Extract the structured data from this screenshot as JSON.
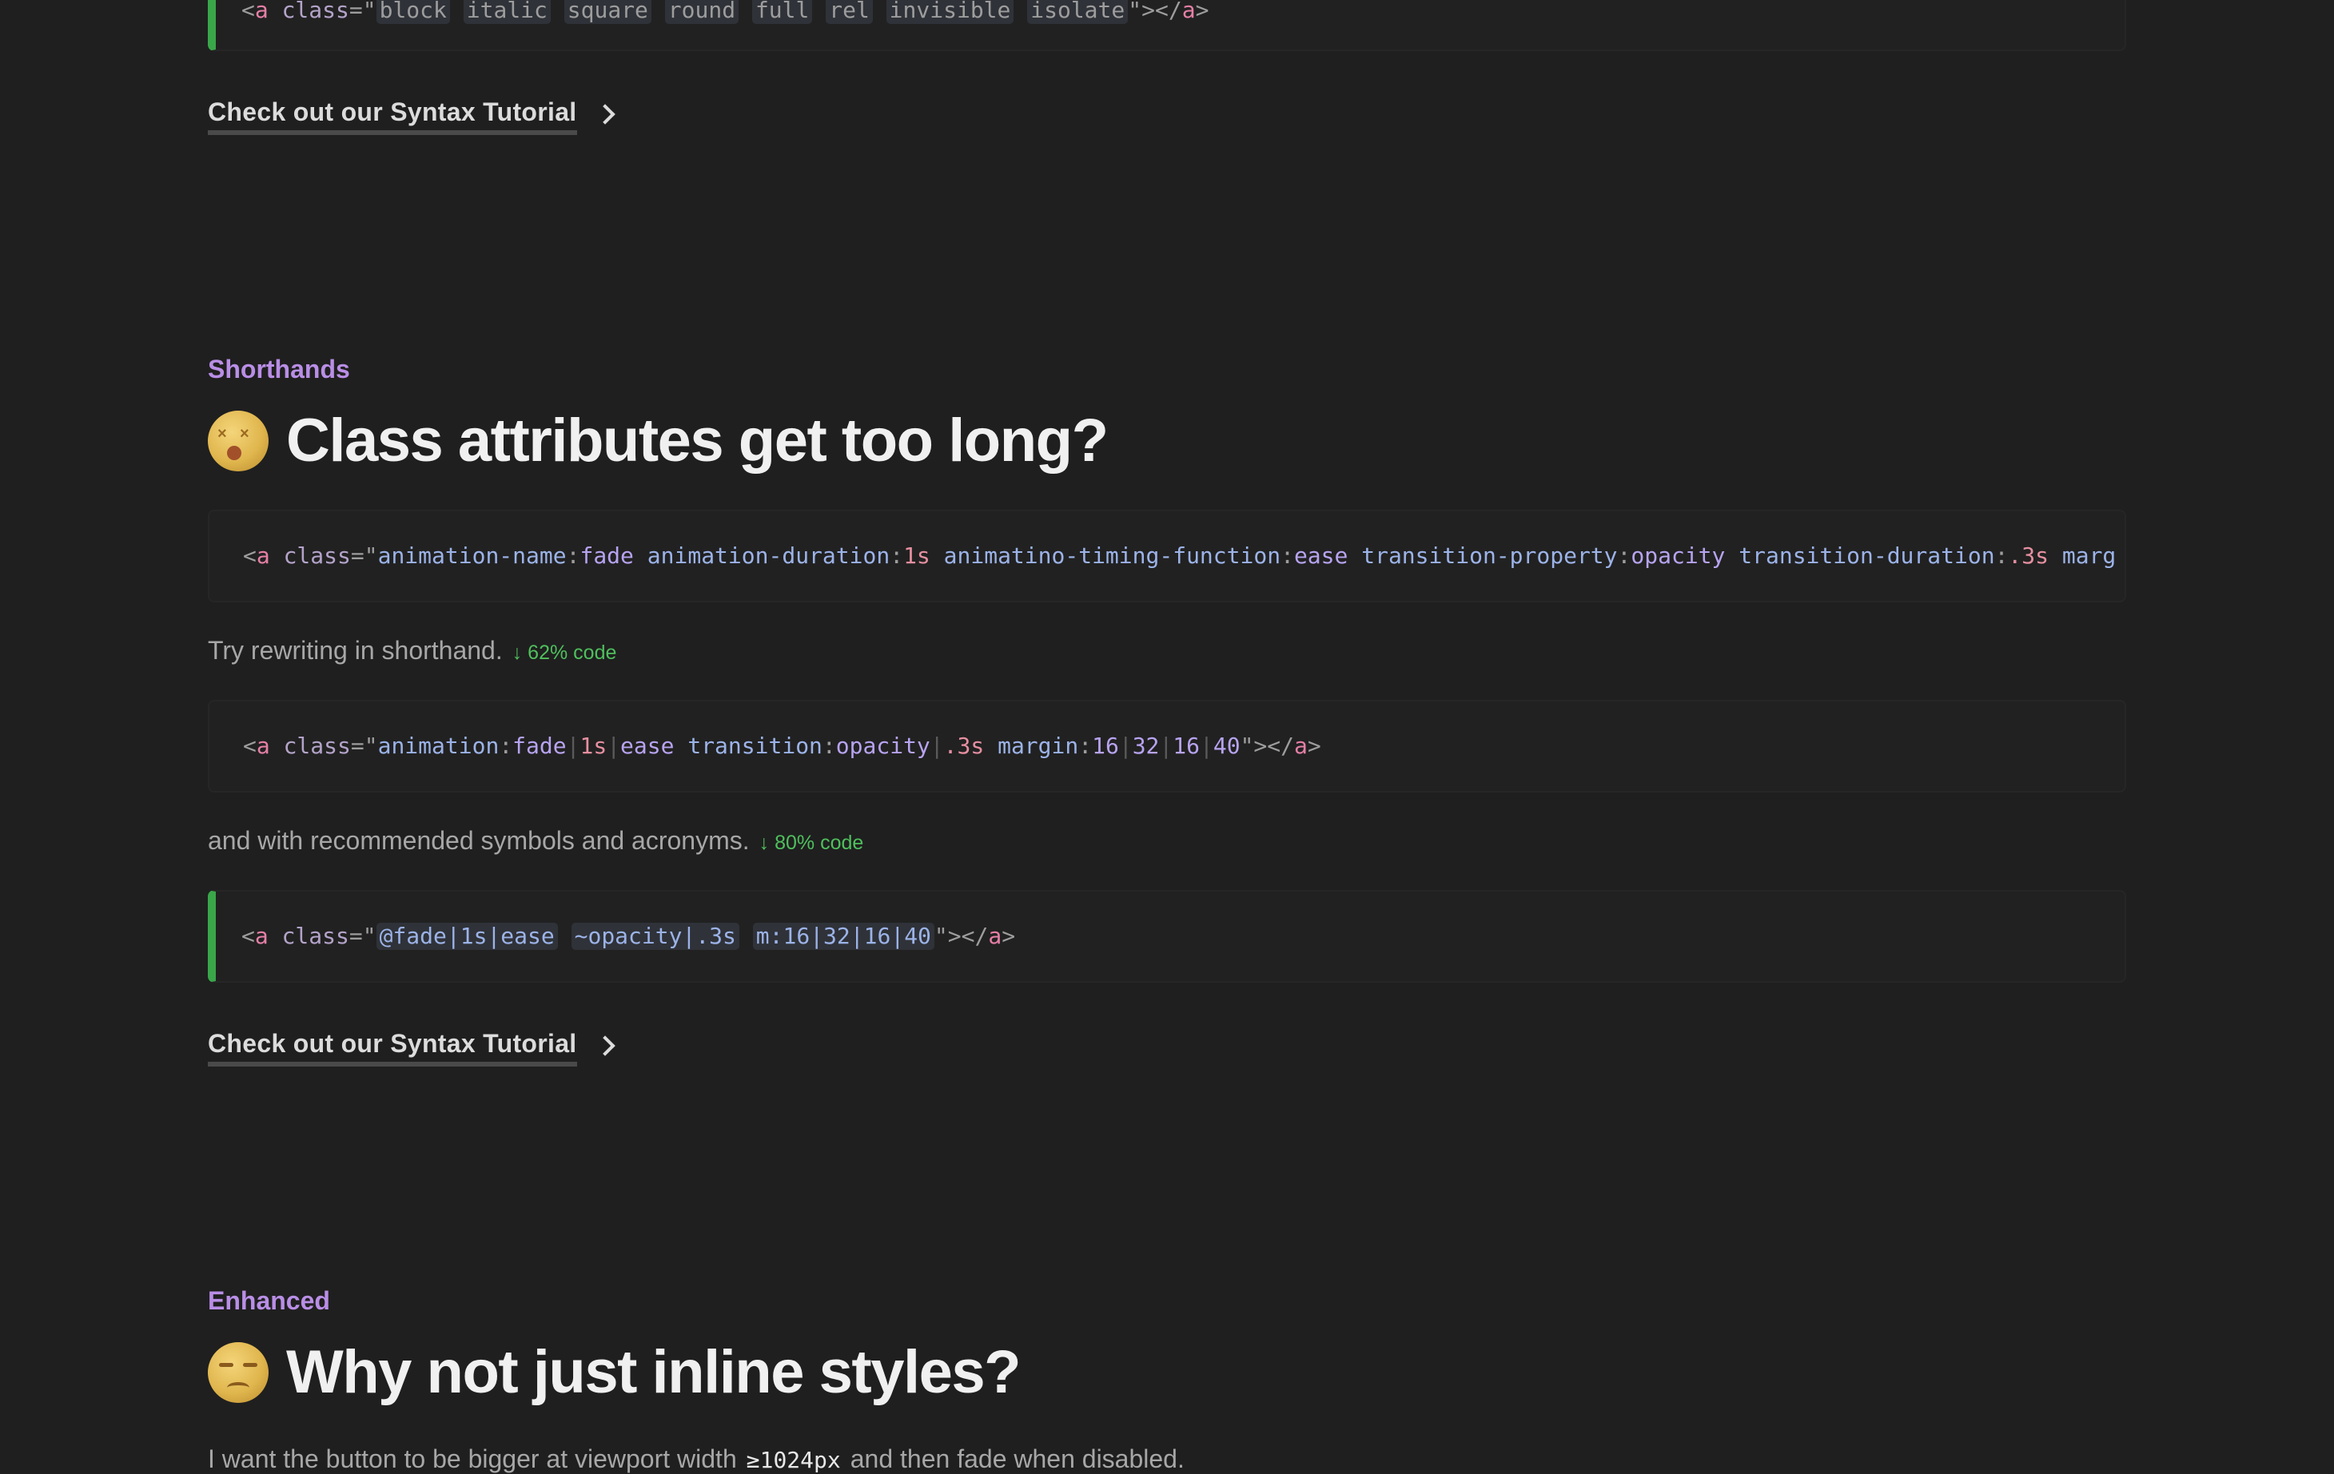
{
  "top_code": {
    "prefix": "<a class=\"",
    "chips": [
      "block",
      "italic",
      "square",
      "round",
      "full",
      "rel",
      "invisible",
      "isolate"
    ],
    "suffix": "\"></a>"
  },
  "tutorial_link_label": "Check out our Syntax Tutorial",
  "shorthands": {
    "eyebrow": "Shorthands",
    "title": "Class attributes get too long?",
    "long_code": "<a class=\"animation-name:fade animation-duration:1s animatino-timing-function:ease transition-property:opacity transition-duration:.3s marg",
    "rewrite_text": "Try rewriting in shorthand.",
    "rewrite_badge": "↓ 62% code",
    "short_code": "<a class=\"animation:fade|1s|ease transition:opacity|.3s margin:16|32|16|40\"></a>",
    "symbols_text": "and with recommended symbols and acronyms.",
    "symbols_badge": "↓ 80% code",
    "symbol_code": {
      "prefix": "<a class=\"",
      "chips": [
        "@fade|1s|ease",
        "~opacity|.3s",
        "m:16|32|16|40"
      ],
      "suffix": "\"></a>"
    }
  },
  "enhanced": {
    "eyebrow": "Enhanced",
    "title": "Why not just inline styles?",
    "intro_before": "I want the button to be bigger at viewport width",
    "intro_code": "≥1024px",
    "intro_after": "and then fade when disabled."
  },
  "colors": {
    "background": "#1f1f1f",
    "accent_green": "#3aa64a",
    "eyebrow_purple": "#b98ee6",
    "badge_green": "#4fbf5d"
  },
  "icons": {
    "shorthands_emoji": "dizzy-face-icon",
    "enhanced_emoji": "unamused-face-icon",
    "link_chevron": "chevron-right-icon"
  }
}
